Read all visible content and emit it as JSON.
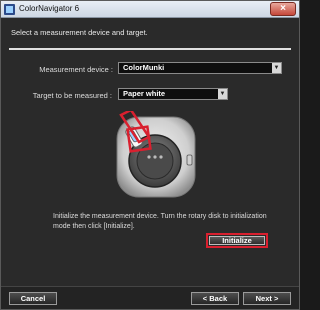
{
  "window": {
    "title": "ColorNavigator 6",
    "close_glyph": "×"
  },
  "instruction": "Select a measurement device and target.",
  "form": {
    "device_label": "Measurement device :",
    "device_value": "ColorMunki",
    "target_label": "Target to be measured :",
    "target_value": "Paper white",
    "arrow_glyph": "▼"
  },
  "help_text": "Initialize the measurement device. Turn the rotary disk to initialization mode then click [Initialize].",
  "buttons": {
    "initialize": "Initialize",
    "cancel": "Cancel",
    "back": "< Back",
    "next": "Next >"
  },
  "colors": {
    "highlight": "#d9202f",
    "background": "#2a2a2a"
  }
}
